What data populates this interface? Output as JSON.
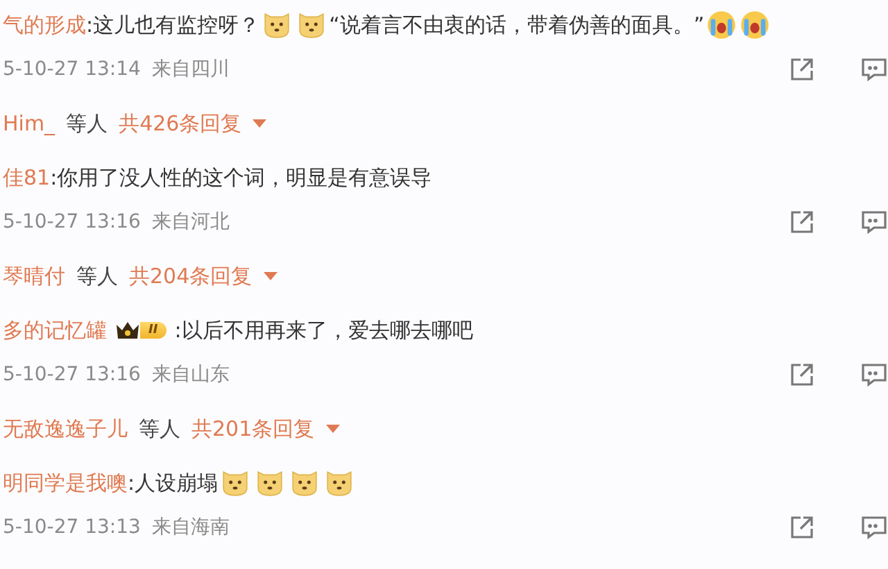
{
  "comments": [
    {
      "author": "气的形成",
      "segments": [
        {
          "kind": "text",
          "text": ":这儿也有监控呀？"
        },
        {
          "kind": "dog"
        },
        {
          "kind": "dog"
        },
        {
          "kind": "text",
          "text": "“说着言不由衷的话，带着伪善的面具。”"
        },
        {
          "kind": "crying"
        },
        {
          "kind": "crying"
        }
      ],
      "time": "5-10-27 13:14",
      "location": "来自四川",
      "replies": {
        "names": "Him_",
        "suffix": "等人",
        "count": "共426条回复"
      }
    },
    {
      "author": "佳81",
      "segments": [
        {
          "kind": "text",
          "text": ":你用了没人性的这个词，明显是有意误导"
        }
      ],
      "time": "5-10-27 13:16",
      "location": "来自河北",
      "replies": {
        "names": "琴晴付",
        "suffix": "等人",
        "count": "共204条回复"
      }
    },
    {
      "author": "多的记忆罐",
      "badge": "II",
      "segments": [
        {
          "kind": "text",
          "text": ":以后不用再来了，爱去哪去哪吧"
        }
      ],
      "time": "5-10-27 13:16",
      "location": "来自山东",
      "replies": {
        "names": "无敌逸逸子儿",
        "suffix": "等人",
        "count": "共201条回复"
      }
    },
    {
      "author": "明同学是我噢",
      "segments": [
        {
          "kind": "text",
          "text": ":人设崩塌"
        },
        {
          "kind": "dog"
        },
        {
          "kind": "dog"
        },
        {
          "kind": "dog"
        },
        {
          "kind": "dog"
        }
      ],
      "time": "5-10-27 13:13",
      "location": "来自海南"
    }
  ]
}
